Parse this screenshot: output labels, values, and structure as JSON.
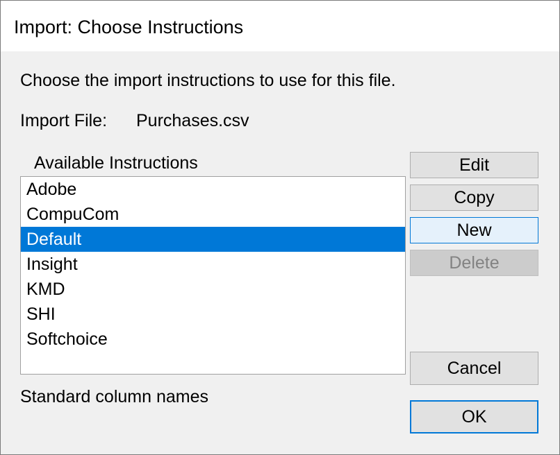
{
  "dialog": {
    "title": "Import: Choose Instructions",
    "prompt": "Choose the import instructions to use for this file.",
    "import_file_label": "Import File:",
    "import_file_value": "Purchases.csv",
    "available_label": "Available Instructions",
    "status_text": "Standard column names"
  },
  "instructions": {
    "items": [
      "Adobe",
      "CompuCom",
      "Default",
      "Insight",
      "KMD",
      "SHI",
      "Softchoice"
    ],
    "selected": "Default"
  },
  "buttons": {
    "edit": "Edit",
    "copy": "Copy",
    "new": "New",
    "delete": "Delete",
    "cancel": "Cancel",
    "ok": "OK"
  },
  "colors": {
    "selection": "#0078d7",
    "button_face": "#e1e1e1",
    "dialog_background": "#f0f0f0",
    "disabled_text": "#838383"
  }
}
